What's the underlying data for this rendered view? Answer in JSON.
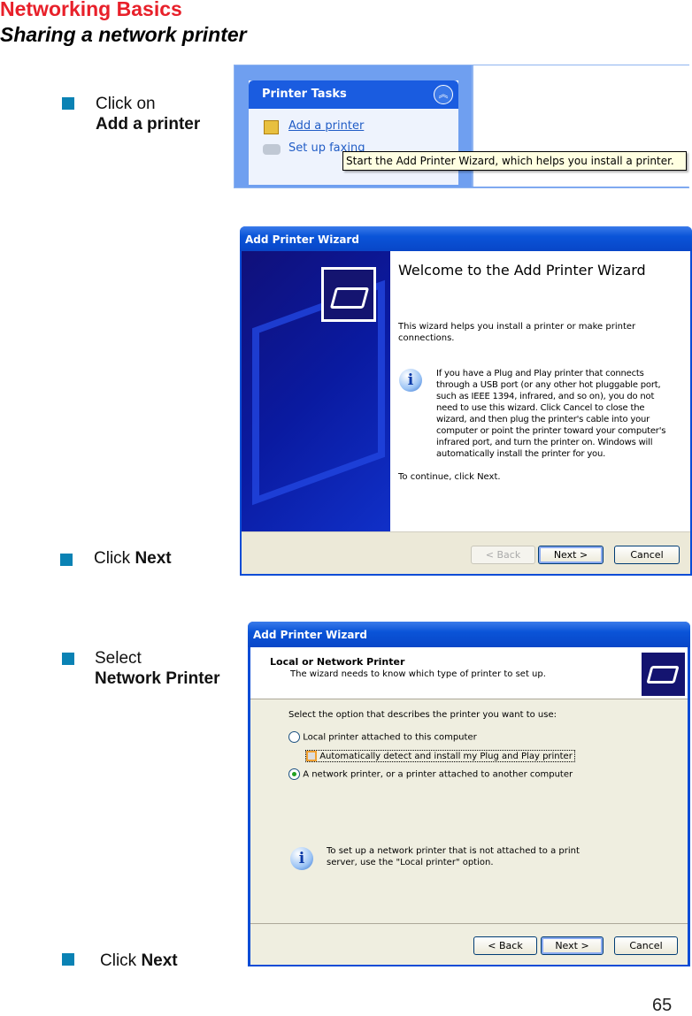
{
  "page": {
    "title": "Networking Basics",
    "subtitle": "Sharing a network printer",
    "page_number": "65"
  },
  "steps": [
    {
      "line1": "Click on",
      "line2": "Add a printer"
    },
    {
      "prefix": "Click ",
      "bold": "Next"
    },
    {
      "line1": "Select",
      "line2": "Network Printer"
    },
    {
      "prefix": "Click ",
      "bold": "Next"
    }
  ],
  "shot1": {
    "panel_title": "Printer Tasks",
    "items": [
      "Add a printer",
      "Set up faxing"
    ],
    "tooltip": "Start the Add Printer Wizard, which helps you install a printer."
  },
  "shot2": {
    "window_title": "Add Printer Wizard",
    "heading": "Welcome to the Add Printer Wizard",
    "intro": "This wizard helps you install a printer or make printer connections.",
    "info": "If you have a Plug and Play printer that connects through a USB port (or any other hot pluggable port, such as IEEE 1394, infrared, and so on), you do not need to use this wizard. Click Cancel to close the wizard, and then plug the printer's cable into your computer or point the printer toward your computer's infrared port, and turn the printer on. Windows will automatically install the printer for you.",
    "continue": "To continue, click Next.",
    "back": "< Back",
    "next": "Next >",
    "cancel": "Cancel"
  },
  "shot3": {
    "window_title": "Add Printer Wizard",
    "heading": "Local or Network Printer",
    "subheading": "The wizard needs to know which type of printer to set up.",
    "prompt": "Select the option that describes the printer you want to use:",
    "option_local": "Local printer attached to this computer",
    "option_auto": "Automatically detect and install my Plug and Play printer",
    "option_network": "A network printer, or a printer attached to another computer",
    "info": "To set up a network printer that is not attached to a print server, use the \"Local printer\" option.",
    "back": "< Back",
    "next": "Next >",
    "cancel": "Cancel",
    "selected": "network"
  },
  "colors": {
    "title": "#e8202a",
    "bullet": "#0a82b4",
    "xp_blue": "#0a54d8"
  }
}
